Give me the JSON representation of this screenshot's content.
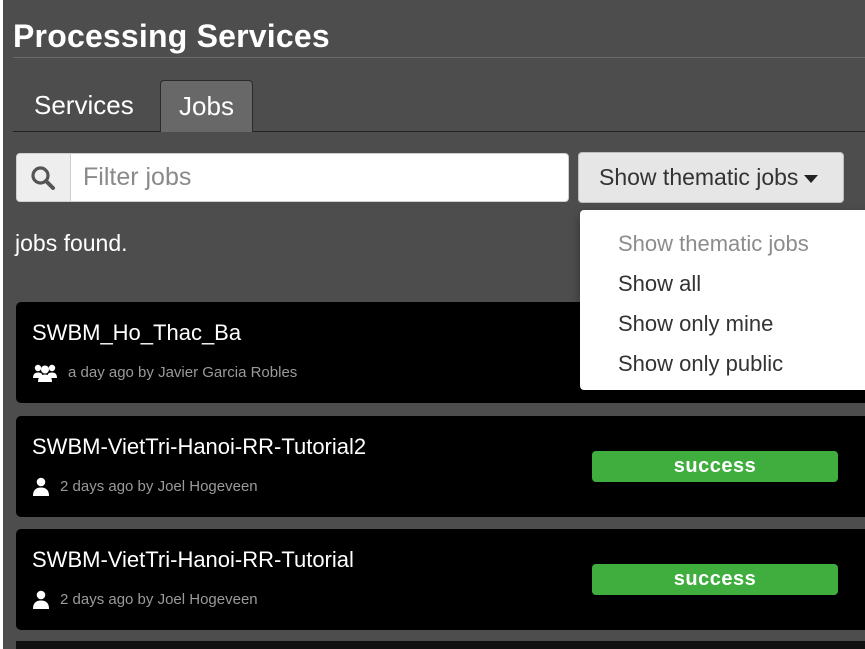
{
  "header": {
    "title": "Processing Services"
  },
  "tabs": [
    {
      "label": "Services",
      "active": false
    },
    {
      "label": "Jobs",
      "active": true
    }
  ],
  "search": {
    "placeholder": "Filter jobs",
    "value": "",
    "icon": "search-icon"
  },
  "filter": {
    "button_label": "Show thematic jobs",
    "options": [
      "Show thematic jobs",
      "Show all",
      "Show only mine",
      "Show only public"
    ]
  },
  "results": {
    "found_text": "jobs found."
  },
  "jobs": [
    {
      "name": "SWBM_Ho_Thac_Ba",
      "time": "a day ago by Javier Garcia Robles",
      "icon": "group-icon",
      "status": ""
    },
    {
      "name": "SWBM-VietTri-Hanoi-RR-Tutorial2",
      "time": "2 days ago by Joel Hogeveen",
      "icon": "user-icon",
      "status": "success"
    },
    {
      "name": "SWBM-VietTri-Hanoi-RR-Tutorial",
      "time": "2 days ago by Joel Hogeveen",
      "icon": "user-icon",
      "status": "success"
    }
  ],
  "colors": {
    "panel": "#4d4d4d",
    "job_bg": "#000000",
    "success": "#3fae3f"
  }
}
